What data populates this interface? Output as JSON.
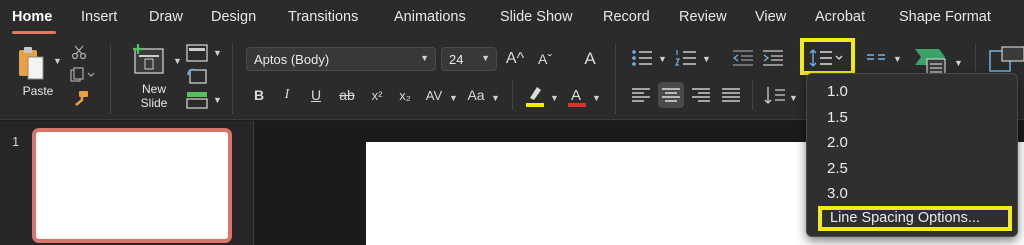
{
  "tabs": [
    "Home",
    "Insert",
    "Draw",
    "Design",
    "Transitions",
    "Animations",
    "Slide Show",
    "Record",
    "Review",
    "View",
    "Acrobat",
    "Shape Format"
  ],
  "ribbon": {
    "paste_label": "Paste",
    "new_slide_line1": "New",
    "new_slide_line2": "Slide",
    "font_name": "Aptos (Body)",
    "font_size": "24",
    "bold": "B",
    "italic": "I",
    "underline": "U",
    "strike": "ab",
    "superscript": "x²",
    "subscript": "x₂",
    "char_spacing": "AV",
    "change_case": "Aa",
    "grow_font": "A^",
    "shrink_font": "Aˇ",
    "clear_format": "A"
  },
  "line_spacing_menu": {
    "options": [
      "1.0",
      "1.5",
      "2.0",
      "2.5",
      "3.0"
    ],
    "more_options": "Line Spacing Options..."
  },
  "slides": {
    "number": "1"
  },
  "colors": {
    "highlight_box": "#f2ea1a",
    "thumb_border": "#d9756a",
    "highlight_swatch": "#f2ea1a",
    "font_color_swatch": "#e03030"
  }
}
